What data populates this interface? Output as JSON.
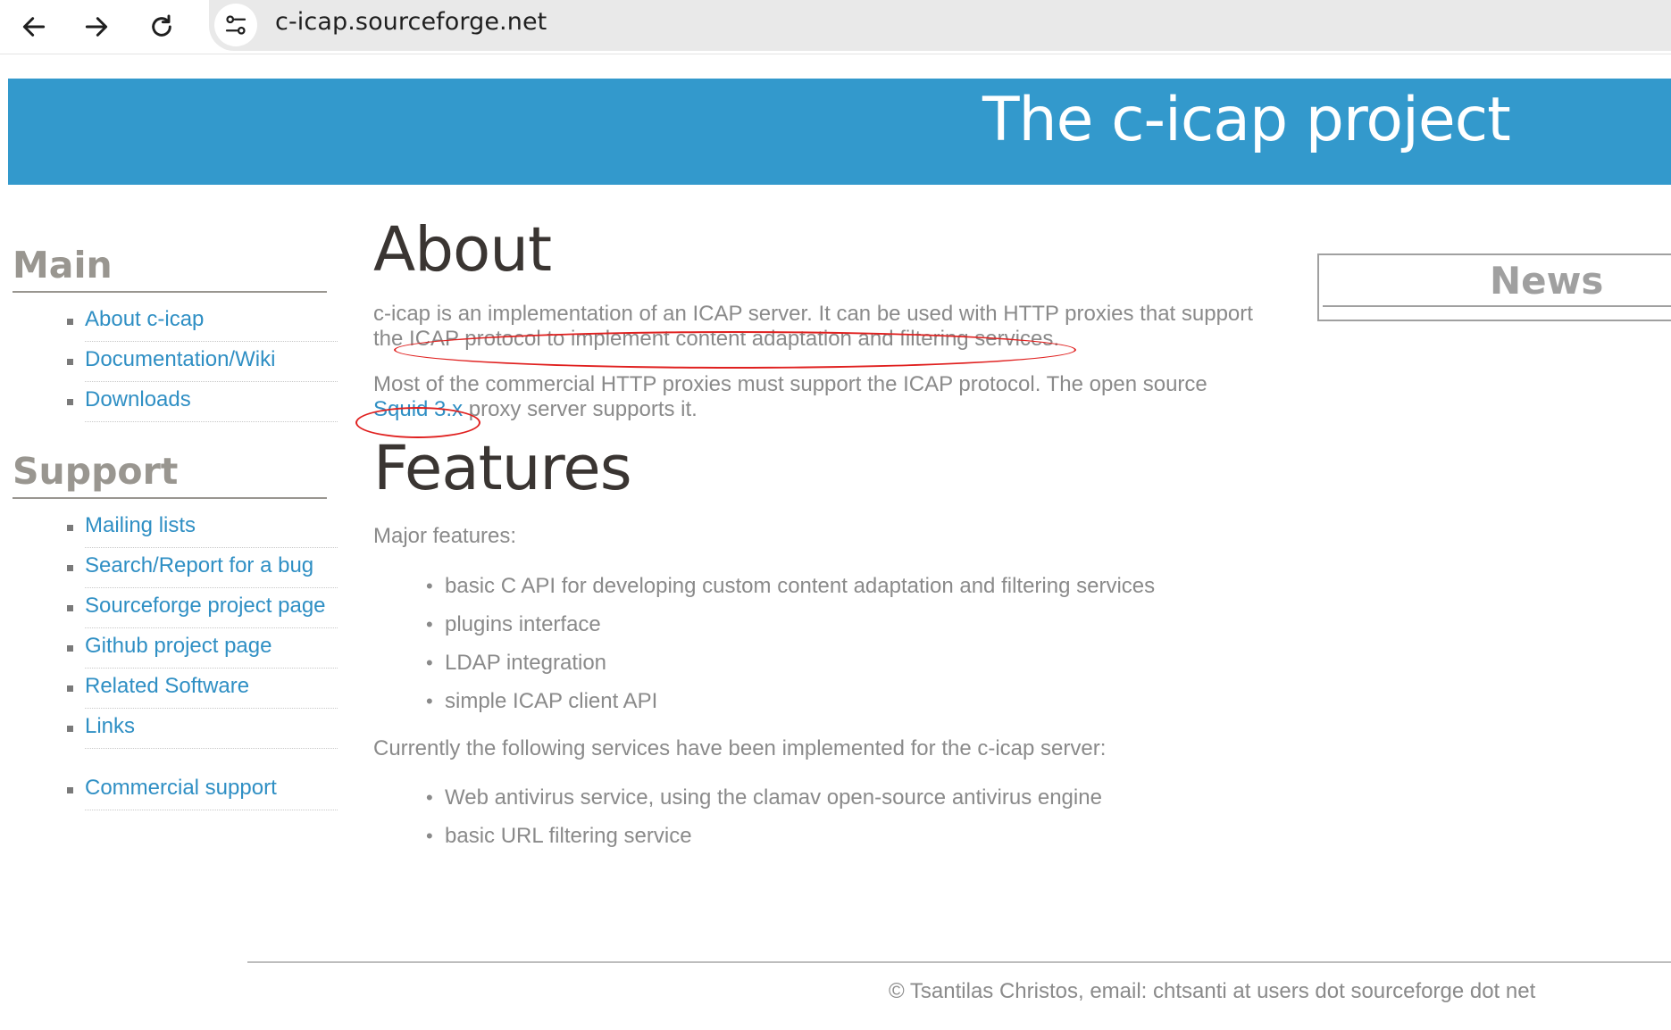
{
  "browser": {
    "url": "c-icap.sourceforge.net",
    "back_icon": "arrow-left",
    "forward_icon": "arrow-right",
    "reload_icon": "reload",
    "site_info_icon": "tune"
  },
  "banner": {
    "title": "The c-icap project",
    "color": "#3399cc"
  },
  "sidebar": {
    "main_heading": "Main",
    "main_items": [
      "About c-icap",
      "Documentation/Wiki",
      "Downloads"
    ],
    "support_heading": "Support",
    "support_items": [
      "Mailing lists",
      "Search/Report for a bug",
      "Sourceforge project page",
      "Github project page",
      "Related Software",
      "Links"
    ],
    "commercial_item": "Commercial support"
  },
  "content": {
    "about_heading": "About",
    "about_p1_a": "c-icap is an implementation of an ICAP server. It can be used with HTTP proxies that support",
    "about_p1_b": "the ICAP protocol to implement content adaptation and filtering services.",
    "about_p2_a": "Most of the commercial HTTP proxies must support the ICAP protocol. The open source",
    "about_p2_link": "Squid 3.x",
    "about_p2_b": " proxy server supports it.",
    "features_heading": "Features",
    "features_intro": "Major features:",
    "features_items": [
      "basic C API for developing custom content adaptation and filtering services",
      "plugins interface",
      "LDAP integration",
      "simple ICAP client API"
    ],
    "services_intro": "Currently the following services have been implemented for the c-icap server:",
    "services_items": [
      "Web antivirus service, using the clamav open-source antivirus engine",
      "basic URL filtering service"
    ]
  },
  "news": {
    "title": "News"
  },
  "footer": {
    "text": "© Tsantilas Christos, email: chtsanti at users dot sourceforge dot net"
  },
  "colors": {
    "link": "#2f8fc4",
    "annotation": "#e0201f",
    "heading": "#999690"
  }
}
